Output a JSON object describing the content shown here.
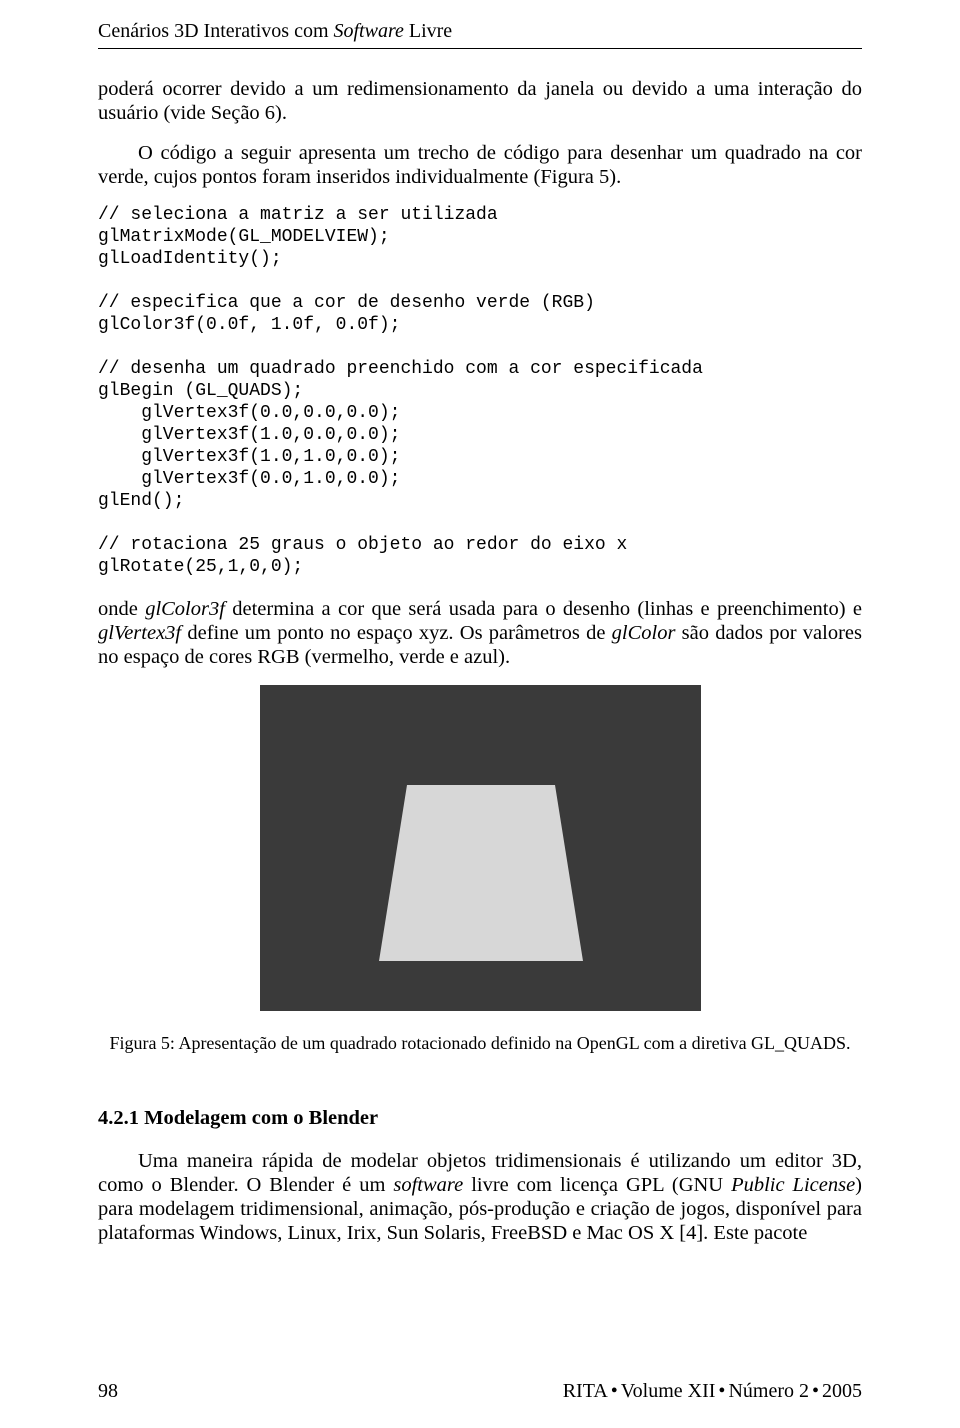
{
  "header": {
    "title_plain": "Cenários 3D Interativos com ",
    "title_italic": "Software",
    "title_tail": " Livre"
  },
  "para1": "poderá ocorrer devido a um redimensionamento da janela ou devido a uma interação do usuário (vide Seção 6).",
  "para2": "O código a seguir apresenta um trecho de código para desenhar um quadrado na cor verde, cujos pontos foram inseridos individualmente (Figura 5).",
  "code": "// seleciona a matriz a ser utilizada\nglMatrixMode(GL_MODELVIEW);\nglLoadIdentity();\n\n// especifica que a cor de desenho verde (RGB)\nglColor3f(0.0f, 1.0f, 0.0f);\n\n// desenha um quadrado preenchido com a cor especificada\nglBegin (GL_QUADS);\n    glVertex3f(0.0,0.0,0.0);\n    glVertex3f(1.0,0.0,0.0);\n    glVertex3f(1.0,1.0,0.0);\n    glVertex3f(0.0,1.0,0.0);\nglEnd();\n\n// rotaciona 25 graus o objeto ao redor do eixo x\nglRotate(25,1,0,0);",
  "para3": {
    "a": "onde ",
    "b": "glColor3f",
    "c": "  determina a cor que será usada para o desenho (linhas e preenchimento) e ",
    "d": "glVertex3f",
    "e": " define um ponto no espaço xyz. Os parâmetros de ",
    "f": "glColor",
    "g": " são dados por valores no espaço de cores RGB (vermelho, verde e azul)."
  },
  "figure": {
    "caption": "Figura 5: Apresentação de um quadrado rotacionado definido na OpenGL com a diretiva GL_QUADS."
  },
  "section": {
    "number": "4.2.1",
    "title": "Modelagem com o Blender"
  },
  "para4": {
    "a": "Uma maneira rápida de modelar objetos tridimensionais é utilizando um editor 3D, como o Blender. O Blender é um ",
    "b": "software",
    "c": " livre com licença GPL (GNU ",
    "d": "Public License",
    "e": ") para modelagem tridimensional, animação, pós-produção e criação de jogos, disponível para plataformas Windows, Linux, Irix, Sun Solaris, FreeBSD e Mac OS X [4]. Este pacote"
  },
  "footer": {
    "page": "98",
    "journal": "RITA",
    "volume": "Volume XII",
    "issue": "Número 2",
    "year": "2005"
  }
}
